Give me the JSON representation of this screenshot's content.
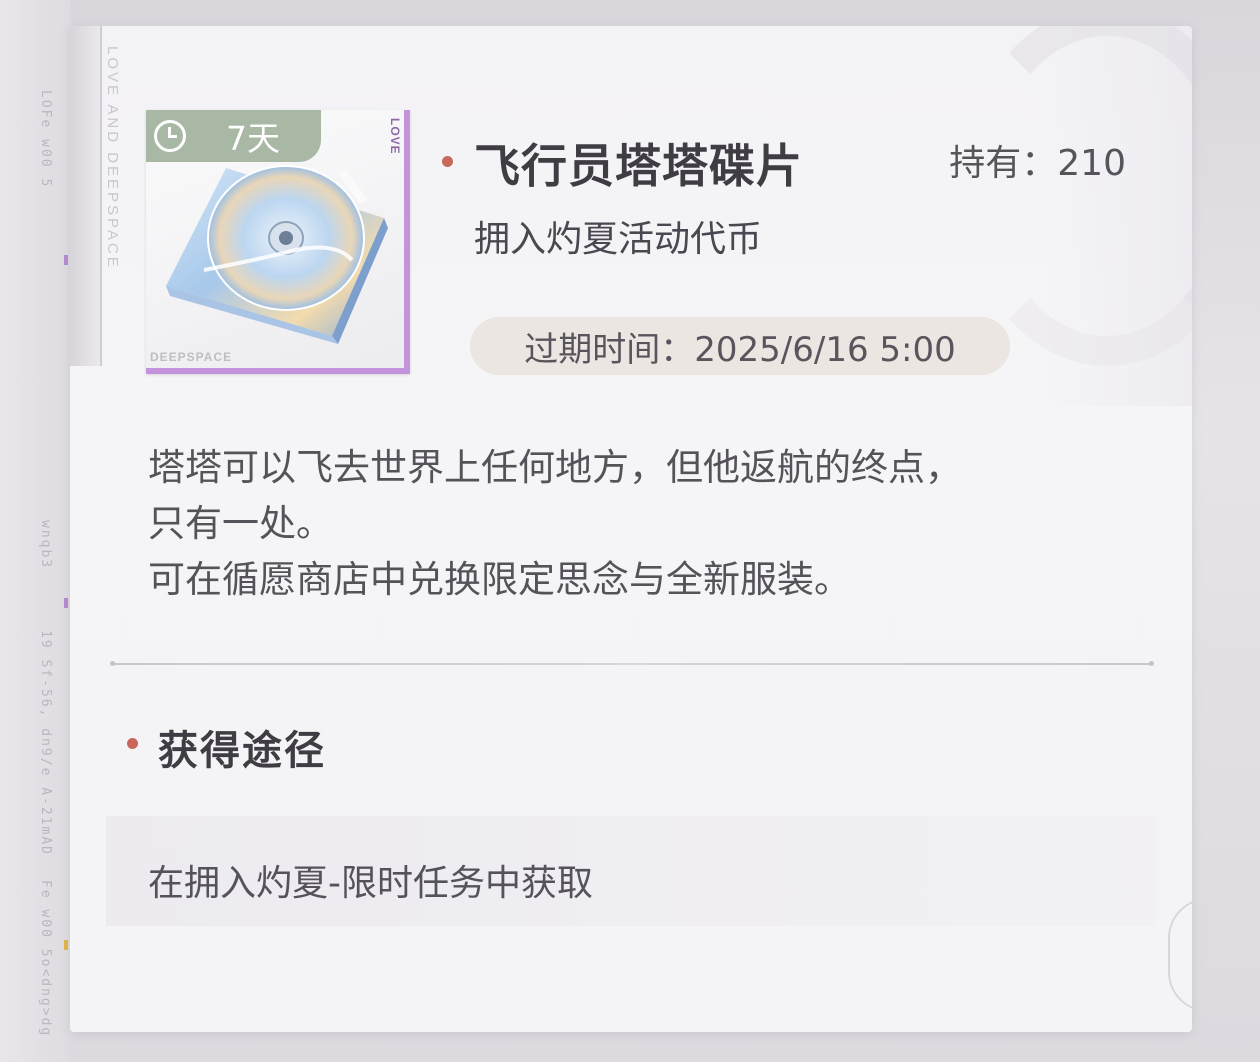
{
  "item": {
    "name": "飞行员塔塔碟片",
    "count_label": "持有：210",
    "subtitle": "拥入灼夏活动代币",
    "expire_label": "过期时间：2025/6/16 5:00",
    "timer_label": "7天",
    "thumb_tag": "LOVE",
    "thumb_brand": "DEEPSPACE",
    "icon": "music-cd-album"
  },
  "description": {
    "lines": [
      "塔塔可以飞去世界上任何地方，但他返航的终点，",
      "只有一处。",
      "可在循愿商店中兑换限定思念与全新服装。"
    ]
  },
  "acquire": {
    "title": "获得途径",
    "source": "在拥入灼夏-限时任务中获取"
  },
  "decor": {
    "card_vertical_text": "LOVE AND DEEPSPACE"
  },
  "colors": {
    "accent_dot": "#c8675a",
    "rarity_purple": "#c394dc",
    "timer_badge": "#96aa91",
    "expire_pill": "#ece6e2"
  }
}
